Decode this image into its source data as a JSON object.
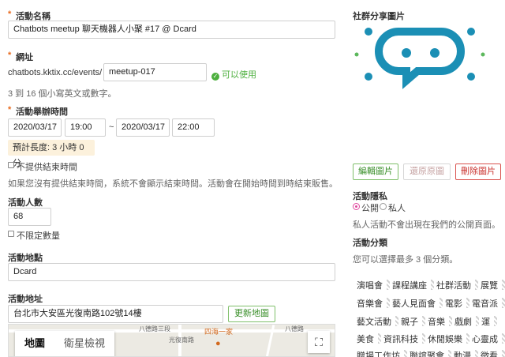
{
  "event_name": {
    "label": "活動名稱",
    "value": "Chatbots meetup 聊天機器人小聚 #17 @ Dcard"
  },
  "url": {
    "label": "網址",
    "prefix": "chatbots.kktix.cc/events/",
    "slug": "meetup-017",
    "status": "可以使用",
    "hint": "3 到 16 個小寫英文或數字。"
  },
  "schedule": {
    "label": "活動舉辦時間",
    "start_date": "2020/03/17",
    "start_time": "19:00",
    "separator": "~",
    "end_date": "2020/03/17",
    "end_time": "22:00",
    "duration": "預計長度: 3 小時 0 分",
    "no_end_label": "不提供結束時間",
    "no_end_hint": "如果您沒有提供結束時間，系統不會顯示結束時間。活動會在開始時間到時結束販售。"
  },
  "attendees": {
    "label": "活動人數",
    "value": "68",
    "unlimited_label": "不限定數量"
  },
  "venue": {
    "label": "活動地點",
    "value": "Dcard"
  },
  "address": {
    "label": "活動地址",
    "value": "台北市大安區光復南路102號14樓",
    "update_button": "更新地圖"
  },
  "map": {
    "tab_map": "地圖",
    "tab_satellite": "衛星檢視",
    "poi": "四海一家",
    "road_labels": [
      "八德路三段",
      "光復南路",
      "八德路"
    ],
    "fullscreen_icon": "fullscreen-icon"
  },
  "share_image": {
    "label": "社群分享圖片",
    "edit_button": "編輯圖片",
    "restore_button": "還原原圖",
    "delete_button": "刪除圖片",
    "colors": {
      "bot_body": "#1b8fb5",
      "dot_green": "#5cb85c",
      "dot_blue": "#1b8fb5"
    }
  },
  "privacy": {
    "label": "活動隱私",
    "public": "公開",
    "private": "私人",
    "hint": "私人活動不會出現在我們的公開頁面。"
  },
  "category": {
    "label": "活動分類",
    "hint": "您可以選擇最多 3 個分類。",
    "rows": [
      [
        "演唱會",
        "課程講座",
        "社群活動",
        "展覽"
      ],
      [
        "音樂會",
        "藝人見面會",
        "電影",
        "電音派"
      ],
      [
        "藝文活動",
        "親子",
        "音樂",
        "戲劇",
        "運"
      ],
      [
        "美食",
        "資訊科技",
        "休閒娛樂",
        "心靈成"
      ],
      [
        "贈場工作坊",
        "聯誼聚會",
        "動漫",
        "徵看"
      ]
    ]
  }
}
